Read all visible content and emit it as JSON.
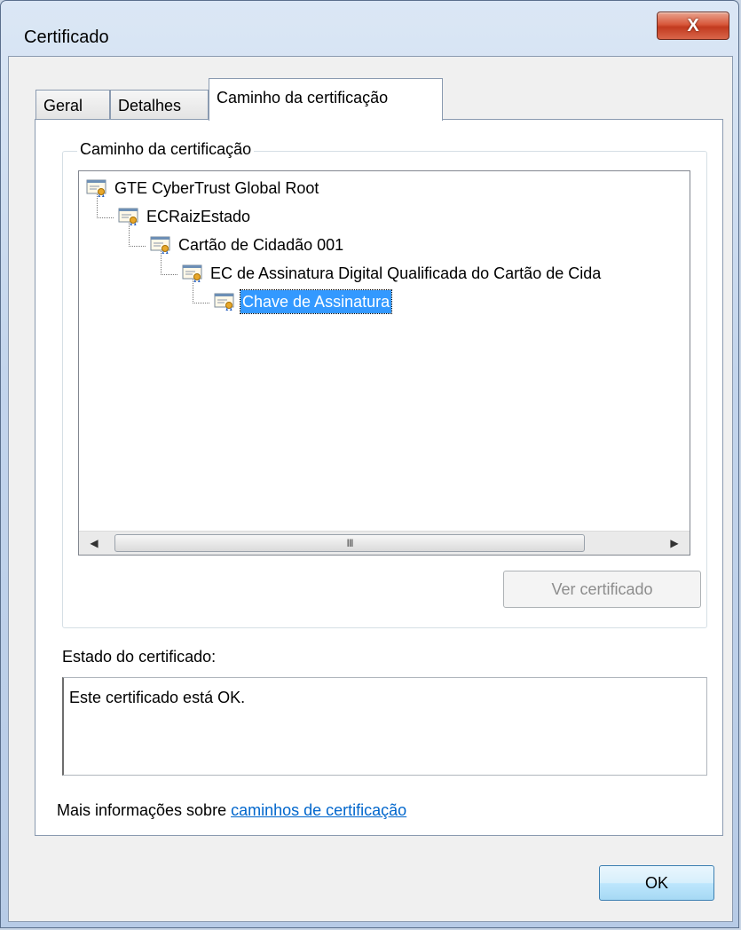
{
  "window": {
    "title": "Certificado",
    "close_glyph": "X"
  },
  "tabs": [
    {
      "label": "Geral"
    },
    {
      "label": "Detalhes"
    },
    {
      "label": "Caminho da certificação"
    }
  ],
  "group": {
    "label": "Caminho da certificação"
  },
  "tree": {
    "items": [
      {
        "label": "GTE CyberTrust Global Root",
        "level": 0,
        "selected": false
      },
      {
        "label": "ECRaizEstado",
        "level": 1,
        "selected": false
      },
      {
        "label": "Cartão de Cidadão 001",
        "level": 2,
        "selected": false
      },
      {
        "label": "EC de Assinatura Digital Qualificada do Cartão de Cida",
        "level": 3,
        "selected": false
      },
      {
        "label": "Chave de Assinatura",
        "level": 4,
        "selected": true
      }
    ],
    "scroll_grip": "III"
  },
  "buttons": {
    "view_cert": "Ver certificado",
    "ok": "OK"
  },
  "status": {
    "label": "Estado do certificado:",
    "text": "Este certificado está OK."
  },
  "info": {
    "prefix": "Mais informações sobre ",
    "link": "caminhos de certificação"
  },
  "colors": {
    "selection": "#3399ff",
    "link": "#0066cc"
  }
}
